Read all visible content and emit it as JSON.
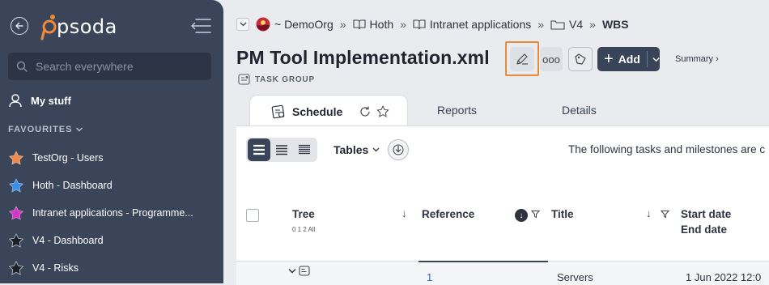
{
  "sidebar": {
    "logo_text": "psoda",
    "search_placeholder": "Search everywhere",
    "my_stuff": "My stuff",
    "favourites_header": "FAVOURITES",
    "favourites": [
      {
        "label": "TestOrg - Users",
        "star_color": "#f08a4b"
      },
      {
        "label": "Hoth - Dashboard",
        "star_color": "#3d8ee8"
      },
      {
        "label": "Intranet applications - Programme...",
        "star_color": "#d634c8"
      },
      {
        "label": "V4 - Dashboard",
        "star_color": "#1c1f26"
      },
      {
        "label": "V4 - Risks",
        "star_color": "#1c1f26"
      }
    ]
  },
  "breadcrumb": {
    "items": [
      "~ DemoOrg",
      "Hoth",
      "Intranet applications",
      "V4",
      "WBS"
    ],
    "separator": "»"
  },
  "header": {
    "title": "PM Tool Implementation.xml",
    "type_label": "TASK GROUP",
    "add_label": "Add",
    "summary_label": "Summary ›",
    "more_label": "ooo"
  },
  "tabs": {
    "schedule": "Schedule",
    "reports": "Reports",
    "details": "Details"
  },
  "toolbar": {
    "tables_label": "Tables",
    "intro_text": "The following tasks and milestones are c"
  },
  "table": {
    "columns": {
      "tree": "Tree",
      "tree_levels": "0 1 2 All",
      "reference": "Reference",
      "title": "Title",
      "start_date": "Start date",
      "end_date": "End date"
    },
    "rows": [
      {
        "reference": "1",
        "title": "Servers",
        "start": "1 Jun 2022 12:0"
      }
    ]
  },
  "colors": {
    "sidebar_bg": "#3b4559",
    "accent_dark": "#3a4458",
    "edit_highlight": "#e88a3a",
    "link": "#2c68c4"
  }
}
